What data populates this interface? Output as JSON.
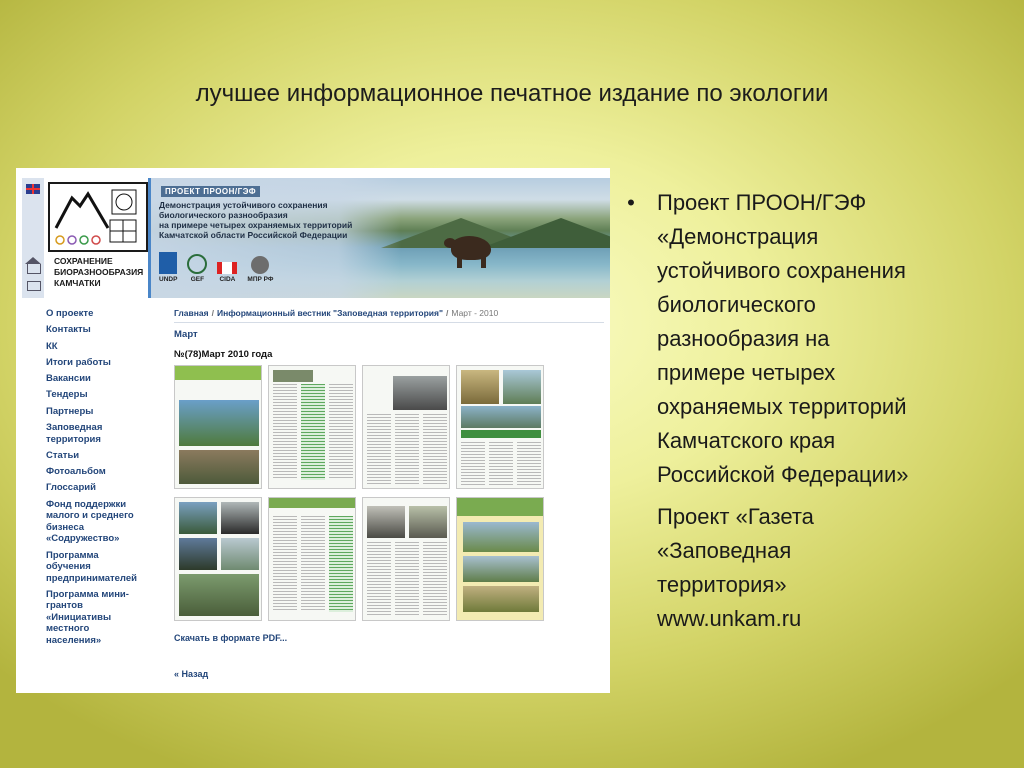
{
  "slide": {
    "title": "лучшее информационное печатное издание по экологии"
  },
  "screenshot": {
    "logo_lines": [
      "СОХРАНЕНИЕ",
      "БИОРАЗНООБРАЗИЯ",
      "КАМЧАТКИ"
    ],
    "logo_undp": "U N D P",
    "banner_tag": "ПРОЕКТ ПРООН/ГЭФ",
    "banner_lines": [
      "Демонстрация устойчивого сохранения",
      "биологического разнообразия",
      "на примере четырех охраняемых территорий",
      "Камчатской области Российской Федерации"
    ],
    "partners": [
      {
        "label": "UNDP"
      },
      {
        "label": "GEF"
      },
      {
        "label": "CIDA"
      },
      {
        "label": "МПР РФ"
      }
    ],
    "nav": [
      [
        "О проекте"
      ],
      [
        "Контакты"
      ],
      [
        "КК"
      ],
      [
        "Итоги работы"
      ],
      [
        "Вакансии"
      ],
      [
        "Тендеры"
      ],
      [
        "Партнеры"
      ],
      [
        "Заповедная",
        "территория"
      ],
      [
        "Статьи"
      ],
      [
        "Фотоальбом"
      ],
      [
        "Глоссарий"
      ],
      [
        "Фонд поддержки",
        "малого и среднего",
        "бизнеса",
        "«Содружество»"
      ],
      [
        "Программа",
        "обучения",
        "предпринимателей"
      ],
      [
        "Программа мини-",
        "грантов",
        "«Инициативы",
        "местного",
        "населения»"
      ]
    ],
    "breadcrumb": {
      "home": "Главная",
      "section": "Информационный вестник \"Заповедная территория\"",
      "current": "Март - 2010"
    },
    "section_heading": "Март",
    "issue_heading": "№(78)Март 2010 года",
    "pdf_link": "Скачать в формате PDF...",
    "back_link": "« Назад"
  },
  "bullet": {
    "project_lines": [
      "Проект ПРООН/ГЭФ",
      "«Демонстрация",
      "устойчивого сохранения",
      "биологического",
      "разнообразия на",
      "примере четырех",
      "охраняемых территорий",
      "Камчатского края",
      "Российской Федерации»"
    ],
    "newspaper_lines": [
      "Проект «Газета",
      "«Заповедная",
      "территория»",
      "www.unkam.ru"
    ]
  }
}
